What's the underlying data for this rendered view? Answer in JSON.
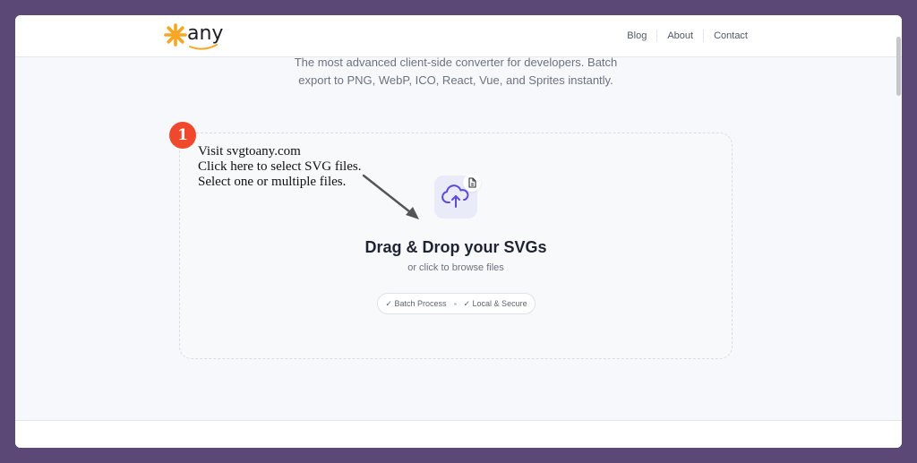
{
  "header": {
    "logo_text": "any",
    "nav": [
      "Blog",
      "About",
      "Contact"
    ]
  },
  "hero": {
    "tagline_line1": "The most advanced client-side converter for developers. Batch",
    "tagline_line2": "export to PNG, WebP, ICO, React, Vue, and Sprites instantly."
  },
  "dropzone": {
    "upload_icon": "cloud-upload-icon",
    "badge_icon": "file-svg-icon",
    "title": "Drag & Drop your SVGs",
    "subtitle": "or click to browse files",
    "features": [
      "✓ Batch Process",
      "✓ Local & Secure"
    ]
  },
  "annotation": {
    "step": "1",
    "lines": [
      "Visit svgtoany.com",
      "Click here to select SVG files.",
      "Select one or multiple files."
    ]
  },
  "colors": {
    "backdrop": "#5c4876",
    "accent": "#5b4bdb",
    "logo_orange": "#f5a623",
    "step_badge": "#f0482c"
  }
}
